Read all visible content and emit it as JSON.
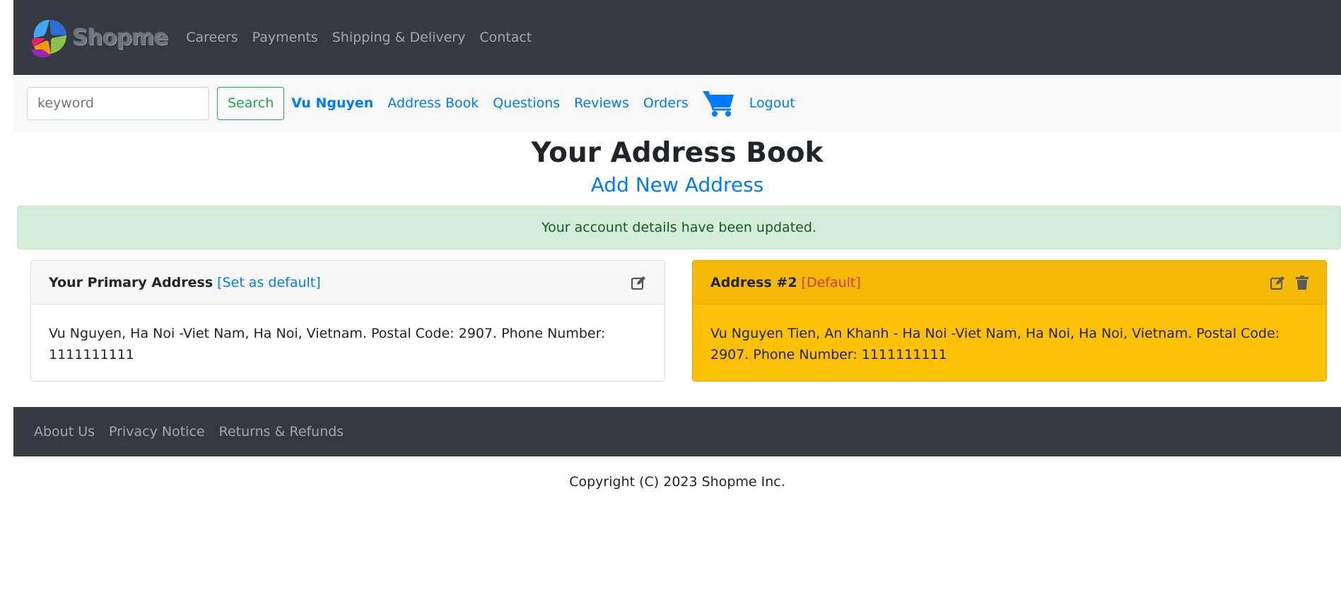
{
  "brand": {
    "name": "Shopme"
  },
  "top_nav": {
    "items": [
      {
        "label": "Careers"
      },
      {
        "label": "Payments"
      },
      {
        "label": "Shipping & Delivery"
      },
      {
        "label": "Contact"
      }
    ]
  },
  "search": {
    "placeholder": "keyword",
    "button_label": "Search"
  },
  "account_nav": {
    "user_name": "Vu Nguyen",
    "items": [
      {
        "label": "Address Book"
      },
      {
        "label": "Questions"
      },
      {
        "label": "Reviews"
      },
      {
        "label": "Orders"
      }
    ],
    "cart_icon": "shopping-cart-icon",
    "logout_label": "Logout"
  },
  "page": {
    "title": "Your Address Book",
    "add_link": "Add New Address",
    "alert": "Your account details have been updated."
  },
  "addresses": [
    {
      "title": "Your Primary Address",
      "tag": "[Set as default]",
      "body": "Vu Nguyen, Ha Noi -Viet Nam, Ha Noi, Vietnam. Postal Code: 2907. Phone Number: 1111111111",
      "icons": [
        "edit-icon"
      ]
    },
    {
      "title": "Address #2",
      "tag": "[Default]",
      "body": "Vu Nguyen Tien, An Khanh - Ha Noi -Viet Nam, Ha Noi, Ha Noi, Vietnam. Postal Code: 2907. Phone Number: 1111111111",
      "icons": [
        "edit-icon",
        "trash-icon"
      ]
    }
  ],
  "footer": {
    "items": [
      {
        "label": "About Us"
      },
      {
        "label": "Privacy Notice"
      },
      {
        "label": "Returns & Refunds"
      }
    ],
    "copyright": "Copyright (C) 2023 Shopme Inc."
  },
  "colors": {
    "navbar_bg": "#343a40",
    "link": "#007bff",
    "success": "#28a745",
    "alert_bg": "#d4edda",
    "default_card": "#ffc107",
    "danger": "#dc3545"
  }
}
